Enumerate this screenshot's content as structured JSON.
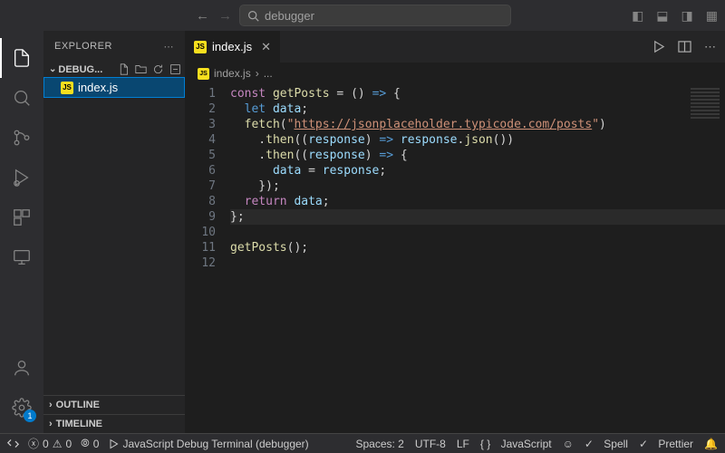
{
  "titlebar": {
    "search_text": "debugger"
  },
  "sidebar": {
    "title": "EXPLORER",
    "folder": "DEBUG...",
    "files": [
      "index.js"
    ],
    "sections": {
      "outline": "OUTLINE",
      "timeline": "TIMELINE"
    },
    "settings_badge": "1"
  },
  "tab": {
    "label": "index.js"
  },
  "breadcrumb": {
    "file": "index.js",
    "rest": "..."
  },
  "code": {
    "lines": [
      {
        "n": 1,
        "tokens": [
          [
            "kw",
            "const"
          ],
          [
            "pun",
            " "
          ],
          [
            "fn",
            "getPosts"
          ],
          [
            "pun",
            " = () "
          ],
          [
            "kw2",
            "=>"
          ],
          [
            "pun",
            " {"
          ]
        ]
      },
      {
        "n": 2,
        "tokens": [
          [
            "pun",
            "  "
          ],
          [
            "kw2",
            "let"
          ],
          [
            "pun",
            " "
          ],
          [
            "var",
            "data"
          ],
          [
            "pun",
            ";"
          ]
        ]
      },
      {
        "n": 3,
        "tokens": [
          [
            "pun",
            "  "
          ],
          [
            "fn",
            "fetch"
          ],
          [
            "pun",
            "("
          ],
          [
            "str",
            "\""
          ],
          [
            "url",
            "https://jsonplaceholder.typicode.com/posts"
          ],
          [
            "str",
            "\""
          ],
          [
            "pun",
            ")"
          ]
        ]
      },
      {
        "n": 4,
        "tokens": [
          [
            "pun",
            "    ."
          ],
          [
            "fn",
            "then"
          ],
          [
            "pun",
            "(("
          ],
          [
            "var",
            "response"
          ],
          [
            "pun",
            ") "
          ],
          [
            "kw2",
            "=>"
          ],
          [
            "pun",
            " "
          ],
          [
            "var",
            "response"
          ],
          [
            "pun",
            "."
          ],
          [
            "fn",
            "json"
          ],
          [
            "pun",
            "())"
          ]
        ]
      },
      {
        "n": 5,
        "tokens": [
          [
            "pun",
            "    ."
          ],
          [
            "fn",
            "then"
          ],
          [
            "pun",
            "(("
          ],
          [
            "var",
            "response"
          ],
          [
            "pun",
            ") "
          ],
          [
            "kw2",
            "=>"
          ],
          [
            "pun",
            " {"
          ]
        ]
      },
      {
        "n": 6,
        "tokens": [
          [
            "pun",
            "      "
          ],
          [
            "var",
            "data"
          ],
          [
            "pun",
            " = "
          ],
          [
            "var",
            "response"
          ],
          [
            "pun",
            ";"
          ]
        ]
      },
      {
        "n": 7,
        "tokens": [
          [
            "pun",
            "    });"
          ]
        ]
      },
      {
        "n": 8,
        "tokens": [
          [
            "pun",
            "  "
          ],
          [
            "kw",
            "return"
          ],
          [
            "pun",
            " "
          ],
          [
            "var",
            "data"
          ],
          [
            "pun",
            ";"
          ]
        ]
      },
      {
        "n": 9,
        "tokens": [
          [
            "pun",
            "};"
          ]
        ],
        "cursor": true
      },
      {
        "n": 10,
        "tokens": [
          [
            "pun",
            ""
          ]
        ]
      },
      {
        "n": 11,
        "tokens": [
          [
            "fn",
            "getPosts"
          ],
          [
            "pun",
            "();"
          ]
        ]
      },
      {
        "n": 12,
        "tokens": [
          [
            "pun",
            ""
          ]
        ]
      }
    ]
  },
  "statusbar": {
    "errors": "0",
    "warnings": "0",
    "ports": "0",
    "debug": "JavaScript Debug Terminal (debugger)",
    "spaces": "Spaces: 2",
    "encoding": "UTF-8",
    "eol": "LF",
    "lang": "JavaScript",
    "spell": "Spell",
    "prettier": "Prettier"
  }
}
